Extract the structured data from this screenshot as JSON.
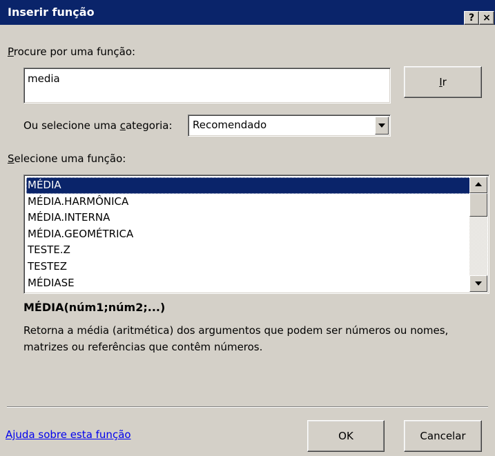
{
  "window": {
    "title": "Inserir função",
    "help_button": "?",
    "close_button": "×"
  },
  "search": {
    "label_accel": "P",
    "label_rest": "rocure por uma função:",
    "value": "media",
    "go_button_accel": "I",
    "go_button_rest": "r"
  },
  "category": {
    "label_pre": "Ou selecione uma ",
    "label_accel": "c",
    "label_rest": "ategoria:",
    "selected": "Recomendado"
  },
  "functions": {
    "label_accel": "S",
    "label_rest": "elecione uma função:",
    "items": [
      "MÉDIA",
      "MÉDIA.HARMÔNICA",
      "MÉDIA.INTERNA",
      "MÉDIA.GEOMÉTRICA",
      "TESTE.Z",
      "TESTEZ",
      "MÉDIASE"
    ],
    "selected_index": 0
  },
  "details": {
    "signature": "MÉDIA(núm1;núm2;...)",
    "description": "Retorna a média (aritmética) dos argumentos que podem ser números ou nomes, matrizes ou referências que contêm números."
  },
  "footer": {
    "help_link": "Ajuda sobre esta função",
    "ok_label": "OK",
    "cancel_label": "Cancelar"
  },
  "colors": {
    "titlebar": "#0a246a",
    "selection": "#0a246a",
    "dialog_bg": "#d4d0c8",
    "link": "#0000ee"
  }
}
